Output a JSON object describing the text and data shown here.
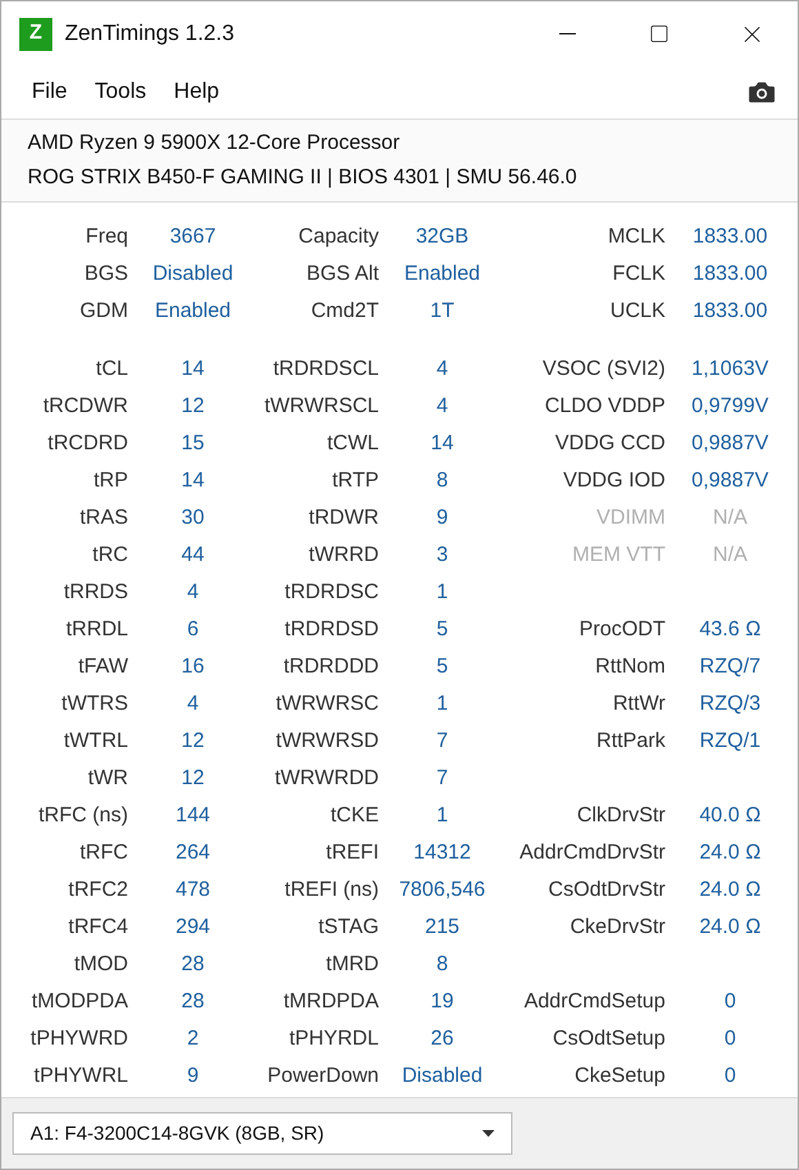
{
  "window": {
    "title": "ZenTimings 1.2.3",
    "logo": "Z"
  },
  "menu": [
    "File",
    "Tools",
    "Help"
  ],
  "info": [
    "AMD Ryzen 9 5900X 12-Core Processor",
    "ROG STRIX B450-F GAMING II | BIOS 4301 | SMU 56.46.0"
  ],
  "summary": [
    {
      "c1": {
        "label": "Freq",
        "value": "3667",
        "disabled": false
      },
      "c2": {
        "label": "Capacity",
        "value": "32GB",
        "disabled": false
      },
      "c3": {
        "label": "MCLK",
        "value": "1833.00",
        "disabled": false
      }
    },
    {
      "c1": {
        "label": "BGS",
        "value": "Disabled",
        "disabled": false
      },
      "c2": {
        "label": "BGS Alt",
        "value": "Enabled",
        "disabled": false
      },
      "c3": {
        "label": "FCLK",
        "value": "1833.00",
        "disabled": false
      }
    },
    {
      "c1": {
        "label": "GDM",
        "value": "Enabled",
        "disabled": false
      },
      "c2": {
        "label": "Cmd2T",
        "value": "1T",
        "disabled": false
      },
      "c3": {
        "label": "UCLK",
        "value": "1833.00",
        "disabled": false
      }
    }
  ],
  "timings": [
    {
      "c1": {
        "label": "tCL",
        "value": "14",
        "disabled": false
      },
      "c2": {
        "label": "tRDRDSCL",
        "value": "4",
        "disabled": false
      },
      "c3": {
        "label": "VSOC (SVI2)",
        "value": "1,1063V",
        "disabled": false
      }
    },
    {
      "c1": {
        "label": "tRCDWR",
        "value": "12",
        "disabled": false
      },
      "c2": {
        "label": "tWRWRSCL",
        "value": "4",
        "disabled": false
      },
      "c3": {
        "label": "CLDO VDDP",
        "value": "0,9799V",
        "disabled": false
      }
    },
    {
      "c1": {
        "label": "tRCDRD",
        "value": "15",
        "disabled": false
      },
      "c2": {
        "label": "tCWL",
        "value": "14",
        "disabled": false
      },
      "c3": {
        "label": "VDDG CCD",
        "value": "0,9887V",
        "disabled": false
      }
    },
    {
      "c1": {
        "label": "tRP",
        "value": "14",
        "disabled": false
      },
      "c2": {
        "label": "tRTP",
        "value": "8",
        "disabled": false
      },
      "c3": {
        "label": "VDDG IOD",
        "value": "0,9887V",
        "disabled": false
      }
    },
    {
      "c1": {
        "label": "tRAS",
        "value": "30",
        "disabled": false
      },
      "c2": {
        "label": "tRDWR",
        "value": "9",
        "disabled": false
      },
      "c3": {
        "label": "VDIMM",
        "value": "N/A",
        "disabled": true
      }
    },
    {
      "c1": {
        "label": "tRC",
        "value": "44",
        "disabled": false
      },
      "c2": {
        "label": "tWRRD",
        "value": "3",
        "disabled": false
      },
      "c3": {
        "label": "MEM VTT",
        "value": "N/A",
        "disabled": true
      }
    },
    {
      "c1": {
        "label": "tRRDS",
        "value": "4",
        "disabled": false
      },
      "c2": {
        "label": "tRDRDSC",
        "value": "1",
        "disabled": false
      }
    },
    {
      "c1": {
        "label": "tRRDL",
        "value": "6",
        "disabled": false
      },
      "c2": {
        "label": "tRDRDSD",
        "value": "5",
        "disabled": false
      },
      "c3": {
        "label": "ProcODT",
        "value": "43.6 Ω",
        "disabled": false
      }
    },
    {
      "c1": {
        "label": "tFAW",
        "value": "16",
        "disabled": false
      },
      "c2": {
        "label": "tRDRDDD",
        "value": "5",
        "disabled": false
      },
      "c3": {
        "label": "RttNom",
        "value": "RZQ/7",
        "disabled": false
      }
    },
    {
      "c1": {
        "label": "tWTRS",
        "value": "4",
        "disabled": false
      },
      "c2": {
        "label": "tWRWRSC",
        "value": "1",
        "disabled": false
      },
      "c3": {
        "label": "RttWr",
        "value": "RZQ/3",
        "disabled": false
      }
    },
    {
      "c1": {
        "label": "tWTRL",
        "value": "12",
        "disabled": false
      },
      "c2": {
        "label": "tWRWRSD",
        "value": "7",
        "disabled": false
      },
      "c3": {
        "label": "RttPark",
        "value": "RZQ/1",
        "disabled": false
      }
    },
    {
      "c1": {
        "label": "tWR",
        "value": "12",
        "disabled": false
      },
      "c2": {
        "label": "tWRWRDD",
        "value": "7",
        "disabled": false
      }
    },
    {
      "c1": {
        "label": "tRFC (ns)",
        "value": "144",
        "disabled": false
      },
      "c2": {
        "label": "tCKE",
        "value": "1",
        "disabled": false
      },
      "c3": {
        "label": "ClkDrvStr",
        "value": "40.0 Ω",
        "disabled": false
      }
    },
    {
      "c1": {
        "label": "tRFC",
        "value": "264",
        "disabled": false
      },
      "c2": {
        "label": "tREFI",
        "value": "14312",
        "disabled": false
      },
      "c3": {
        "label": "AddrCmdDrvStr",
        "value": "24.0 Ω",
        "disabled": false
      }
    },
    {
      "c1": {
        "label": "tRFC2",
        "value": "478",
        "disabled": false
      },
      "c2": {
        "label": "tREFI (ns)",
        "value": "7806,546",
        "disabled": false
      },
      "c3": {
        "label": "CsOdtDrvStr",
        "value": "24.0 Ω",
        "disabled": false
      }
    },
    {
      "c1": {
        "label": "tRFC4",
        "value": "294",
        "disabled": false
      },
      "c2": {
        "label": "tSTAG",
        "value": "215",
        "disabled": false
      },
      "c3": {
        "label": "CkeDrvStr",
        "value": "24.0 Ω",
        "disabled": false
      }
    },
    {
      "c1": {
        "label": "tMOD",
        "value": "28",
        "disabled": false
      },
      "c2": {
        "label": "tMRD",
        "value": "8",
        "disabled": false
      }
    },
    {
      "c1": {
        "label": "tMODPDA",
        "value": "28",
        "disabled": false
      },
      "c2": {
        "label": "tMRDPDA",
        "value": "19",
        "disabled": false
      },
      "c3": {
        "label": "AddrCmdSetup",
        "value": "0",
        "disabled": false
      }
    },
    {
      "c1": {
        "label": "tPHYWRD",
        "value": "2",
        "disabled": false
      },
      "c2": {
        "label": "tPHYRDL",
        "value": "26",
        "disabled": false
      },
      "c3": {
        "label": "CsOdtSetup",
        "value": "0",
        "disabled": false
      }
    },
    {
      "c1": {
        "label": "tPHYWRL",
        "value": "9",
        "disabled": false
      },
      "c2": {
        "label": "PowerDown",
        "value": "Disabled",
        "disabled": false
      },
      "c3": {
        "label": "CkeSetup",
        "value": "0",
        "disabled": false
      }
    }
  ],
  "module_select": {
    "value": "A1: F4-3200C14-8GVK (8GB, SR)"
  }
}
